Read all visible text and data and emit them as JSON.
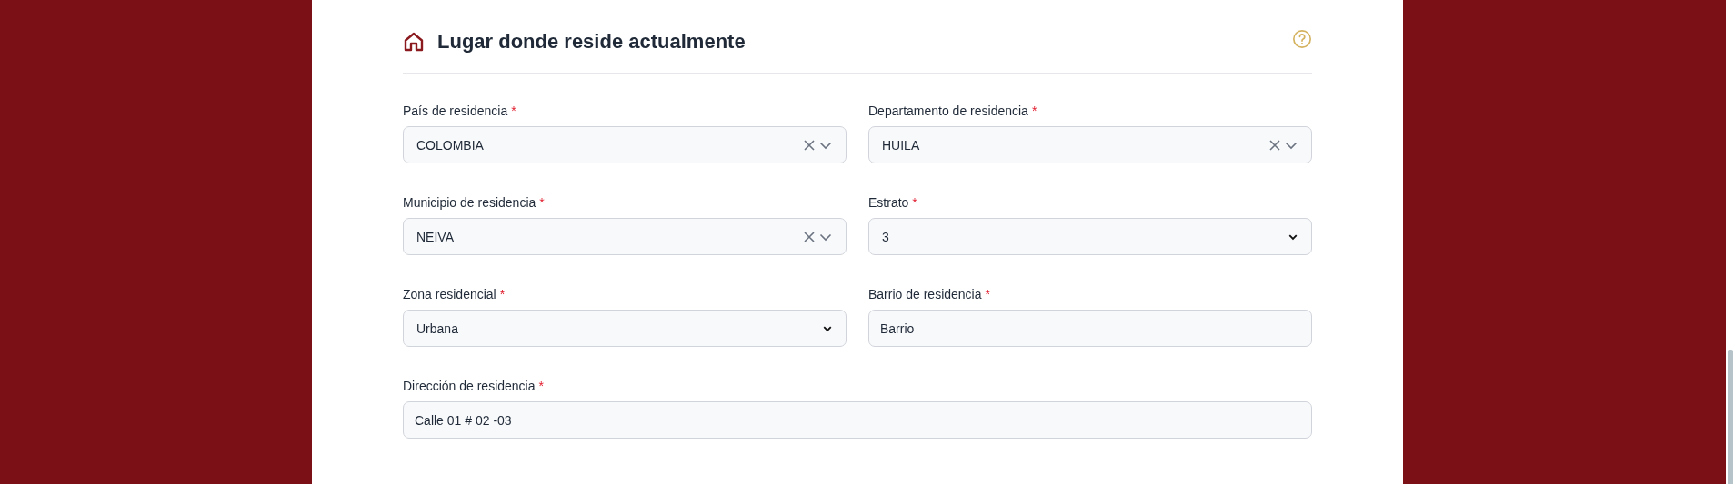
{
  "section": {
    "title": "Lugar donde reside actualmente"
  },
  "fields": [
    {
      "label": "País de residencia",
      "required_mark": "*",
      "kind": "combobox",
      "value": "COLOMBIA"
    },
    {
      "label": "Departamento de residencia",
      "required_mark": "*",
      "kind": "combobox",
      "value": "HUILA"
    },
    {
      "label": "Municipio de residencia",
      "required_mark": "*",
      "kind": "combobox",
      "value": "NEIVA"
    },
    {
      "label": "Estrato",
      "required_mark": "*",
      "kind": "select",
      "value": "3"
    },
    {
      "label": "Zona residencial",
      "required_mark": "*",
      "kind": "select",
      "value": "Urbana"
    },
    {
      "label": "Barrio de residencia",
      "required_mark": "*",
      "kind": "text",
      "value": "Barrio"
    },
    {
      "label": "Dirección de residencia",
      "required_mark": "*",
      "kind": "text",
      "value": "Calle 01 # 02 -03"
    }
  ]
}
